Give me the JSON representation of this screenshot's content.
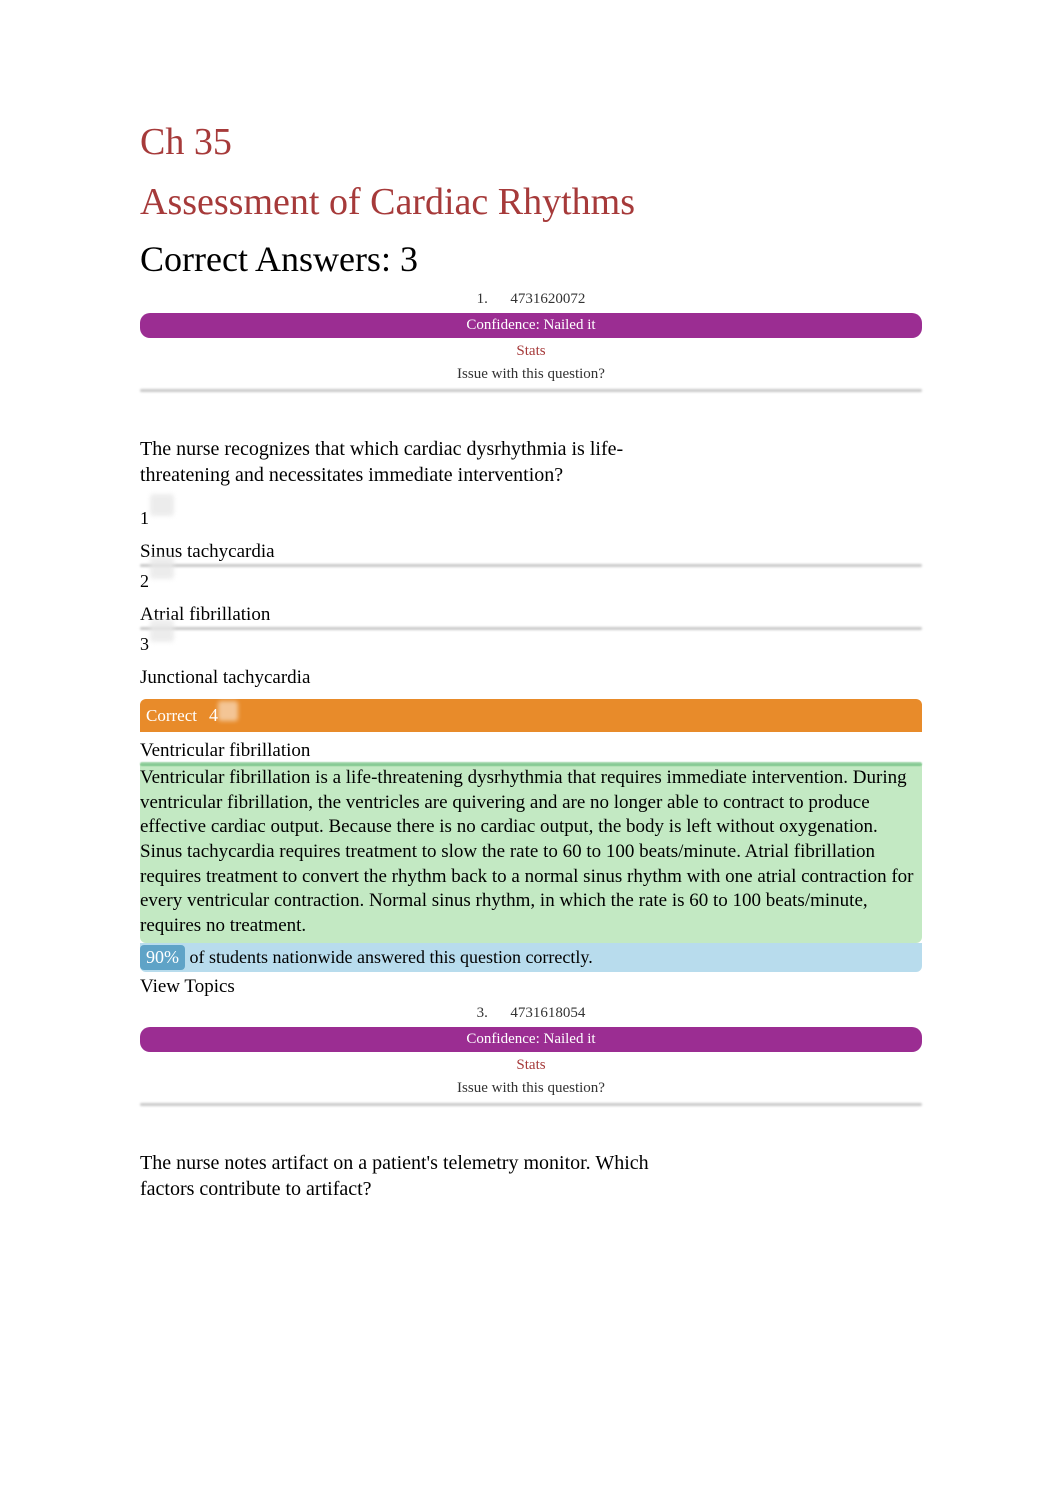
{
  "chapter": "Ch 35",
  "title": "Assessment of Cardiac Rhythms",
  "score": "Correct Answers: 3",
  "q1": {
    "metaNum": "1.",
    "metaId": "4731620072",
    "confidence": "Confidence: Nailed it",
    "stats": "Stats",
    "issue": "Issue with this question?",
    "question": "The nurse recognizes that which cardiac dysrhythmia is life-threatening and necessitates immediate intervention?",
    "opts": {
      "n1": "1",
      "t1": "Sinus tachycardia",
      "n2": "2",
      "t2": "Atrial fibrillation",
      "n3": "3",
      "t3": "Junctional tachycardia",
      "correctLabel": "Correct",
      "n4": "4",
      "t4": "Ventricular fibrillation"
    },
    "explanation": "Ventricular fibrillation is a life-threatening dysrhythmia that requires immediate intervention. During ventricular fibrillation, the ventricles are quivering and are no longer able to contract to produce effective cardiac output. Because there is no cardiac output, the body is left without oxygenation. Sinus tachycardia requires treatment to slow the rate to 60 to 100 beats/minute. Atrial fibrillation requires treatment to convert the rhythm back to a normal sinus rhythm with one atrial contraction for every ventricular contraction. Normal sinus rhythm, in which the rate is 60 to 100 beats/minute, requires no treatment.",
    "percent": "90%",
    "percentText": " of students nationwide answered this question correctly.",
    "viewTopics": "View Topics"
  },
  "q2": {
    "metaNum": "3.",
    "metaId": "4731618054",
    "confidence": "Confidence: Nailed it",
    "stats": "Stats",
    "issue": "Issue with this question?",
    "question": "The nurse notes artifact on a patient's telemetry monitor. Which factors contribute to artifact?"
  }
}
